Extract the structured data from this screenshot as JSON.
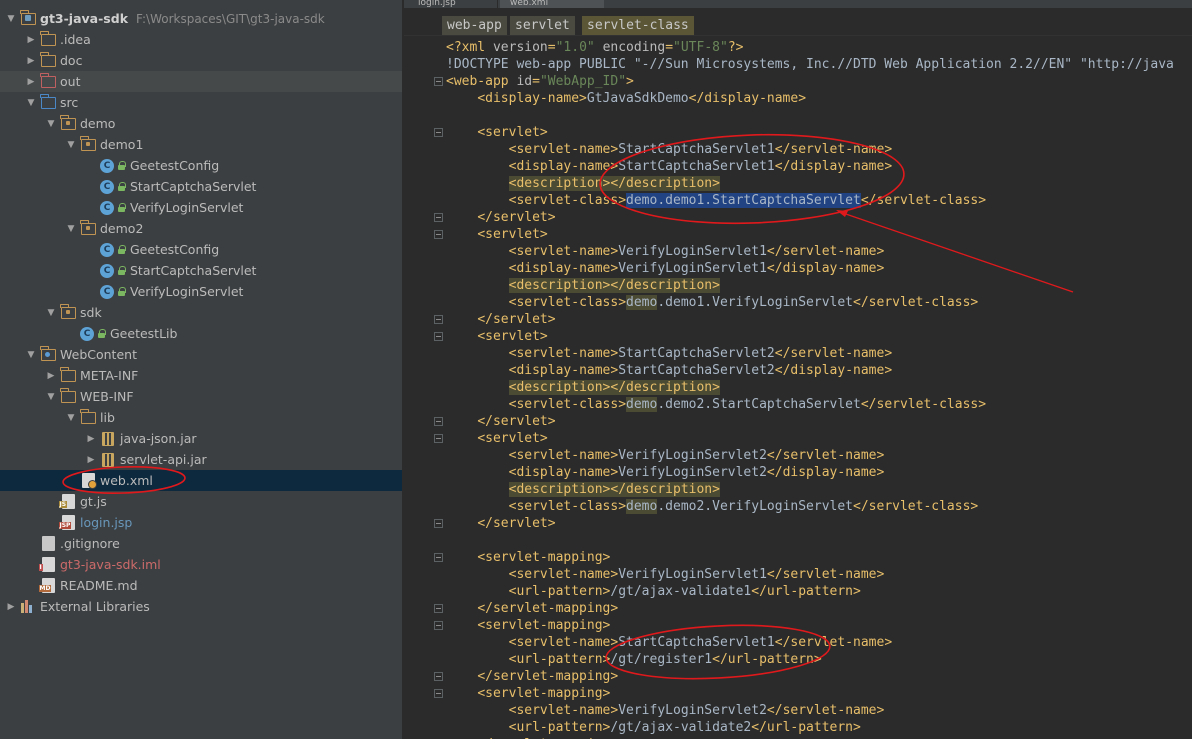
{
  "project_tree": {
    "root": {
      "name": "gt3-java-sdk",
      "path": "F:\\Workspaces\\GIT\\gt3-java-sdk"
    },
    "items": [
      {
        "label": "gt3-java-sdk",
        "path": "F:\\Workspaces\\GIT\\gt3-java-sdk",
        "icon": "project-folder-icon",
        "depth": 0,
        "arrow": "down"
      },
      {
        "label": ".idea",
        "icon": "folder-icon",
        "depth": 1,
        "arrow": "right"
      },
      {
        "label": "doc",
        "icon": "folder-icon",
        "depth": 1,
        "arrow": "right"
      },
      {
        "label": "out",
        "icon": "excluded-folder-icon",
        "depth": 1,
        "arrow": "right"
      },
      {
        "label": "src",
        "icon": "source-folder-icon",
        "depth": 1,
        "arrow": "down"
      },
      {
        "label": "demo",
        "icon": "package-icon",
        "depth": 2,
        "arrow": "down"
      },
      {
        "label": "demo1",
        "icon": "package-icon",
        "depth": 3,
        "arrow": "down"
      },
      {
        "label": "GeetestConfig",
        "icon": "class-icon",
        "depth": 4
      },
      {
        "label": "StartCaptchaServlet",
        "icon": "class-icon",
        "depth": 4
      },
      {
        "label": "VerifyLoginServlet",
        "icon": "class-icon",
        "depth": 4
      },
      {
        "label": "demo2",
        "icon": "package-icon",
        "depth": 3,
        "arrow": "down"
      },
      {
        "label": "GeetestConfig",
        "icon": "class-icon",
        "depth": 4
      },
      {
        "label": "StartCaptchaServlet",
        "icon": "class-icon",
        "depth": 4
      },
      {
        "label": "VerifyLoginServlet",
        "icon": "class-icon",
        "depth": 4
      },
      {
        "label": "sdk",
        "icon": "package-icon",
        "depth": 2,
        "arrow": "down"
      },
      {
        "label": "GeetestLib",
        "icon": "class-icon",
        "depth": 3
      },
      {
        "label": "WebContent",
        "icon": "web-folder-icon",
        "depth": 1,
        "arrow": "down"
      },
      {
        "label": "META-INF",
        "icon": "folder-icon",
        "depth": 2,
        "arrow": "right"
      },
      {
        "label": "WEB-INF",
        "icon": "folder-icon",
        "depth": 2,
        "arrow": "down"
      },
      {
        "label": "lib",
        "icon": "folder-icon",
        "depth": 3,
        "arrow": "down"
      },
      {
        "label": "java-json.jar",
        "icon": "jar-icon",
        "depth": 4,
        "arrow": "right"
      },
      {
        "label": "servlet-api.jar",
        "icon": "jar-icon",
        "depth": 4,
        "arrow": "right"
      },
      {
        "label": "web.xml",
        "icon": "xml-file-icon",
        "depth": 3,
        "selected": true
      },
      {
        "label": "gt.js",
        "icon": "js-file-icon",
        "depth": 2
      },
      {
        "label": "login.jsp",
        "icon": "jsp-file-icon",
        "depth": 2,
        "style": "blue"
      },
      {
        "label": ".gitignore",
        "icon": "text-file-icon",
        "depth": 1
      },
      {
        "label": "gt3-java-sdk.iml",
        "icon": "iml-file-icon",
        "depth": 1,
        "style": "red"
      },
      {
        "label": "README.md",
        "icon": "md-file-icon",
        "depth": 1
      },
      {
        "label": "External Libraries",
        "icon": "libraries-icon",
        "depth": 0,
        "arrow": "right"
      }
    ]
  },
  "editor": {
    "tabs": [
      "login.jsp",
      "web.xml"
    ],
    "breadcrumbs": [
      "web-app",
      "servlet",
      "servlet-class"
    ],
    "lines": [
      "<?xml version=\"1.0\" encoding=\"UTF-8\"?>",
      "<!DOCTYPE web-app PUBLIC \"-//Sun Microsystems, Inc.//DTD Web Application 2.2//EN\" \"http://java",
      "<web-app id=\"WebApp_ID\">",
      "    <display-name>GtJavaSdkDemo</display-name>",
      "",
      "    <servlet>",
      "        <servlet-name>StartCaptchaServlet1</servlet-name>",
      "        <display-name>StartCaptchaServlet1</display-name>",
      "        <description></description>",
      "        <servlet-class>demo.demo1.StartCaptchaServlet</servlet-class>",
      "    </servlet>",
      "    <servlet>",
      "        <servlet-name>VerifyLoginServlet1</servlet-name>",
      "        <display-name>VerifyLoginServlet1</display-name>",
      "        <description></description>",
      "        <servlet-class>demo.demo1.VerifyLoginServlet</servlet-class>",
      "    </servlet>",
      "    <servlet>",
      "        <servlet-name>StartCaptchaServlet2</servlet-name>",
      "        <display-name>StartCaptchaServlet2</display-name>",
      "        <description></description>",
      "        <servlet-class>demo.demo2.StartCaptchaServlet</servlet-class>",
      "    </servlet>",
      "    <servlet>",
      "        <servlet-name>VerifyLoginServlet2</servlet-name>",
      "        <display-name>VerifyLoginServlet2</display-name>",
      "        <description></description>",
      "        <servlet-class>demo.demo2.VerifyLoginServlet</servlet-class>",
      "    </servlet>",
      "",
      "    <servlet-mapping>",
      "        <servlet-name>VerifyLoginServlet1</servlet-name>",
      "        <url-pattern>/gt/ajax-validate1</url-pattern>",
      "    </servlet-mapping>",
      "    <servlet-mapping>",
      "        <servlet-name>StartCaptchaServlet1</servlet-name>",
      "        <url-pattern>/gt/register1</url-pattern>",
      "    </servlet-mapping>",
      "    <servlet-mapping>",
      "        <servlet-name>VerifyLoginServlet2</servlet-name>",
      "        <url-pattern>/gt/ajax-validate2</url-pattern>",
      "    </servlet-mapping>"
    ],
    "selected_text": "demo.demo1.StartCaptchaServlet",
    "selected_line": 9
  },
  "colors": {
    "tree_bg": "#3c3f41",
    "editor_bg": "#2b2b2b",
    "tag": "#e8bf6a",
    "string": "#6a8759",
    "text": "#a9b7c6",
    "selection": "#214283",
    "annotation": "#e0191c"
  }
}
